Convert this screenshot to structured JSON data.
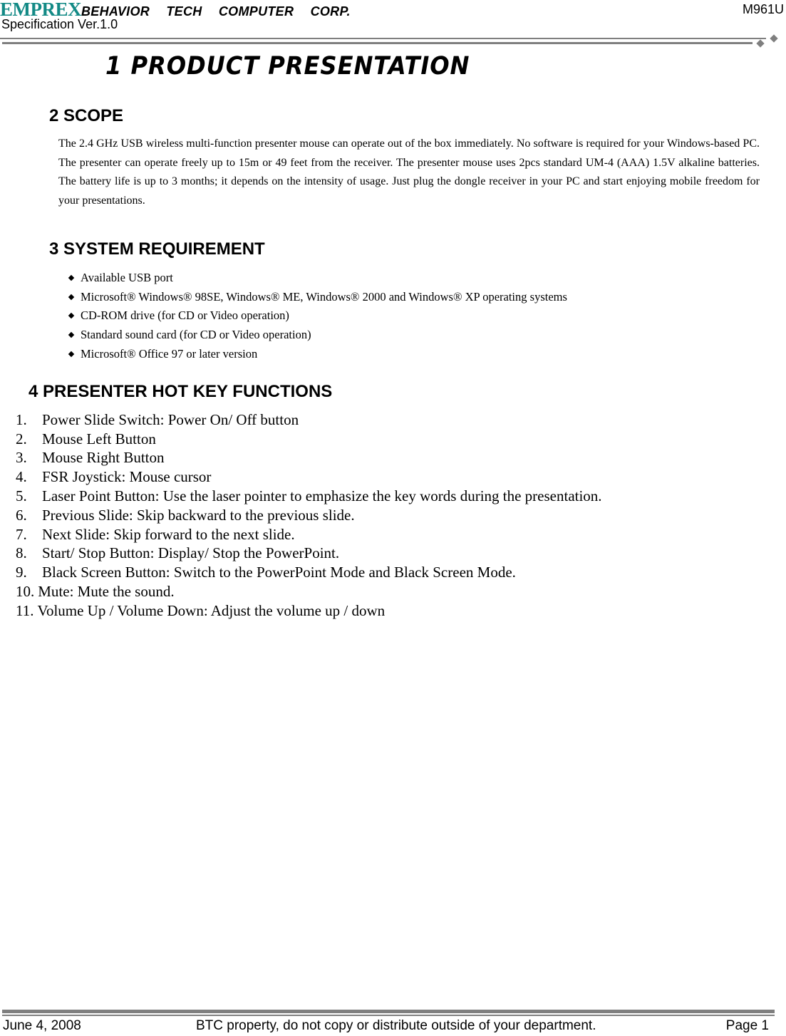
{
  "header": {
    "brand_logo": "EMPREX",
    "company": "BEHAVIOR TECH COMPUTER CORP.",
    "spec_version": "Specification Ver.1.0",
    "model": "M961U"
  },
  "title": "1  PRODUCT PRESENTATION",
  "sections": {
    "scope": {
      "heading": "2 SCOPE",
      "paragraph": "The 2.4 GHz USB wireless multi-function presenter mouse can operate out of the box immediately. No software is required for your Windows-based PC. The presenter can operate freely up to 15m or 49 feet from the receiver. The presenter mouse uses 2pcs standard UM-4 (AAA) 1.5V alkaline batteries. The battery life is up to 3 months; it depends on the intensity of usage. Just plug the dongle receiver in your PC and start enjoying mobile freedom for your presentations."
    },
    "system_requirement": {
      "heading": "3 SYSTEM REQUIREMENT",
      "items": [
        "Available USB port",
        "Microsoft® Windows® 98SE, Windows® ME, Windows® 2000 and Windows® XP operating systems",
        "CD-ROM drive (for CD or Video operation)",
        "Standard sound card (for CD or Video operation)",
        "Microsoft® Office 97 or later version"
      ]
    },
    "hot_keys": {
      "heading": "4 PRESENTER HOT KEY FUNCTIONS",
      "items": [
        {
          "num": "1.",
          "text": "Power Slide Switch: Power On/ Off button"
        },
        {
          "num": "2.",
          "text": "Mouse Left Button"
        },
        {
          "num": "3.",
          "text": "Mouse Right Button"
        },
        {
          "num": "4.",
          "text": "FSR Joystick: Mouse cursor"
        },
        {
          "num": "5.",
          "text": "Laser Point Button: Use the laser pointer to emphasize the key words during the presentation."
        },
        {
          "num": "6.",
          "text": "Previous Slide: Skip backward to the previous slide."
        },
        {
          "num": "7.",
          "text": "Next Slide: Skip forward to the next slide."
        },
        {
          "num": "8.",
          "text": "Start/ Stop Button: Display/ Stop the PowerPoint."
        },
        {
          "num": "9.",
          "text": "Black Screen Button: Switch to the PowerPoint Mode and Black Screen Mode."
        },
        {
          "num": "10.",
          "text": "Mute: Mute the sound."
        },
        {
          "num": "11.",
          "text": "Volume Up / Volume Down: Adjust the volume up / down"
        }
      ]
    }
  },
  "footer": {
    "date": "June 4, 2008",
    "notice": "BTC property, do not copy or distribute outside of your department.",
    "page": "Page 1"
  },
  "colors": {
    "brand": "#138a86",
    "rule": "#7f7f7f"
  }
}
